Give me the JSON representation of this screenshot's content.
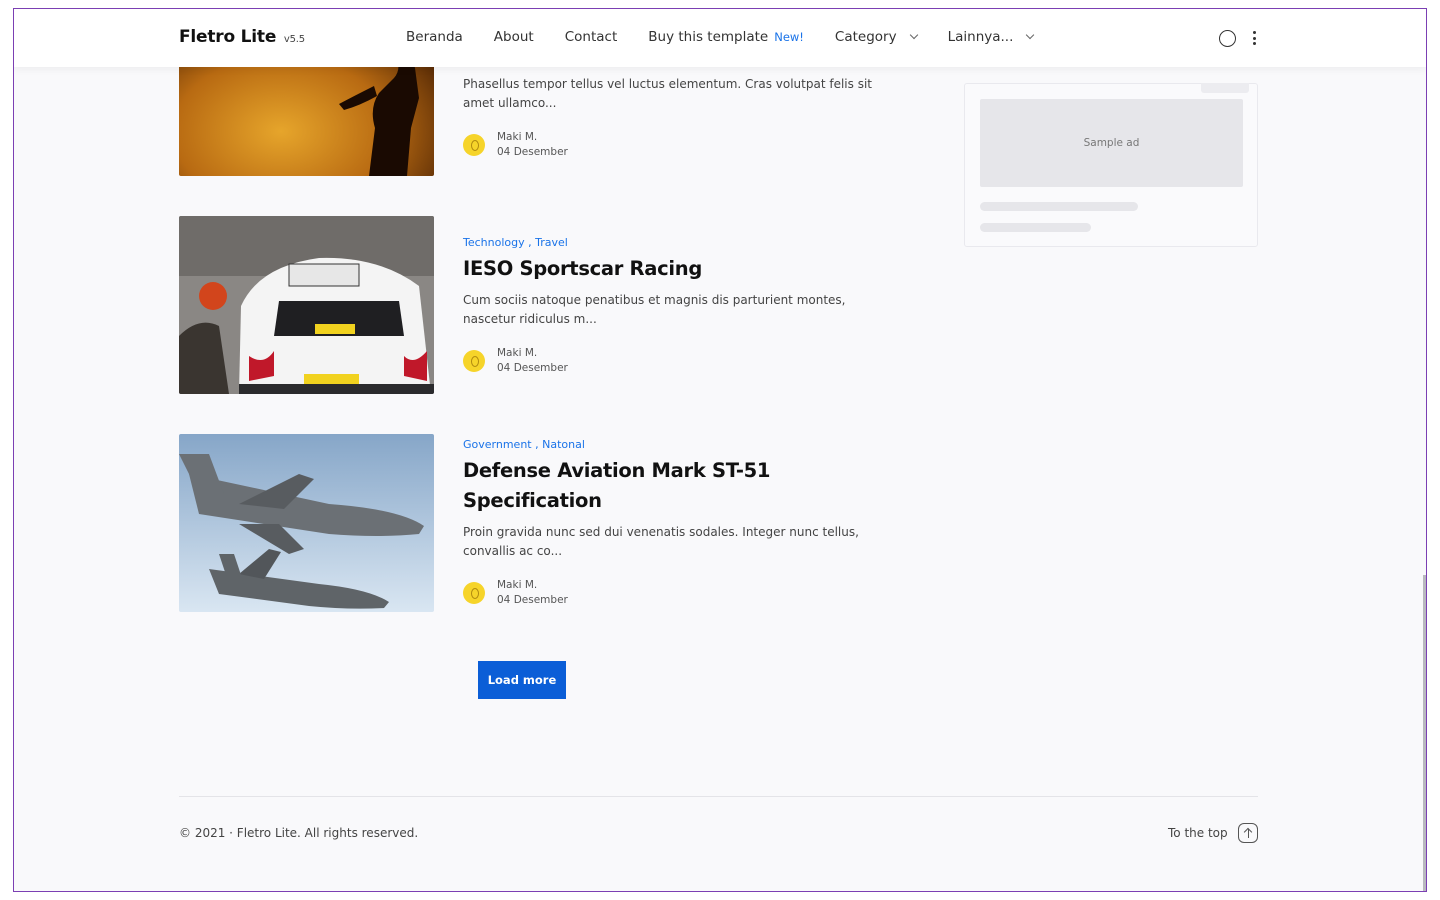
{
  "header": {
    "brand": "Fletro Lite",
    "version": "v5.5",
    "nav": [
      {
        "label": "Beranda"
      },
      {
        "label": "About"
      },
      {
        "label": "Contact"
      },
      {
        "label": "Buy this template",
        "badge": "New!"
      },
      {
        "label": "Category"
      },
      {
        "label": "Lainnya..."
      }
    ]
  },
  "posts": [
    {
      "categories": [],
      "title": "",
      "excerpt": "Phasellus tempor tellus vel luctus elementum. Cras volutpat felis sit amet ullamco...",
      "author": "Maki M.",
      "date": "04 Desember"
    },
    {
      "categories": [
        "Technology",
        "Travel"
      ],
      "title": "IESO Sportscar Racing",
      "excerpt": "Cum sociis natoque penatibus et magnis dis parturient montes, nascetur ridiculus m...",
      "author": "Maki M.",
      "date": "04 Desember"
    },
    {
      "categories": [
        "Government",
        "Natonal"
      ],
      "title": "Defense Aviation Mark ST-51 Specification",
      "excerpt": "Proin gravida nunc sed dui venenatis sodales. Integer nunc tellus, convallis ac co...",
      "author": "Maki M.",
      "date": "04 Desember"
    }
  ],
  "sidebar": {
    "ad_label": "Sample ad"
  },
  "load_more": "Load more",
  "footer": {
    "copyright": "© 2021 · Fletro Lite. All rights reserved.",
    "to_top": "To the top"
  },
  "colors": {
    "accent": "#0b5ed7",
    "link": "#1a73e8",
    "avatar": "#f6d42a",
    "frame_border": "#7b3fb3"
  }
}
